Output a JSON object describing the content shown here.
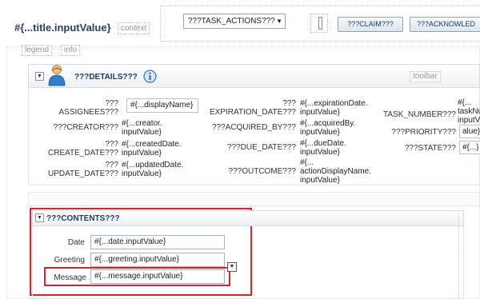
{
  "header": {
    "title": "#{...title.inputValue}",
    "context_placeholder": "context",
    "task_actions": "???TASK_ACTIONS???",
    "claim_label": "???CLAIM???",
    "acknowledge_label": "???ACKNOWLED"
  },
  "placeholders": {
    "legend": "legend",
    "info": "info",
    "toolbar": "toolbar"
  },
  "details": {
    "title": "???DETAILS???",
    "assignees": {
      "label_line1": "???",
      "label_line2": "ASSIGNEES???",
      "value": "#{...displayName}"
    },
    "creator": {
      "label": "???CREATOR???",
      "value_line1": "#{...creator.",
      "value_line2": "inputValue}"
    },
    "create_date": {
      "label_line1": "???",
      "label_line2": "CREATE_DATE???",
      "value_line1": "#{...createdDate.",
      "value_line2": "inputValue}"
    },
    "update_date": {
      "label_line1": "???",
      "label_line2": "UPDATE_DATE???",
      "value_line1": "#{...updatedDate.",
      "value_line2": "inputValue}"
    },
    "expiration_date": {
      "label_line1": "???",
      "label_line2": "EXPIRATION_DATE???",
      "value_line1": "#{...expirationDate.",
      "value_line2": "inputValue}"
    },
    "acquired_by": {
      "label": "???ACQUIRED_BY???",
      "value_line1": "#{...acquiredBy.",
      "value_line2": "inputValue}"
    },
    "due_date": {
      "label": "???DUE_DATE???",
      "value_line1": "#{...dueDate.",
      "value_line2": "inputValue}"
    },
    "outcome": {
      "label": "???OUTCOME???",
      "value_line1": "#{...",
      "value_line2": "actionDisplayName.",
      "value_line3": "inputValue}"
    },
    "task_number": {
      "label": "TASK_NUMBER???",
      "value_line1": "#{...",
      "value_line2": "taskNu",
      "value_line3": "inputV"
    },
    "priority": {
      "label": "???PRIORITY???",
      "value": "alue}"
    },
    "state": {
      "label": "???STATE???",
      "value": "#{...}"
    }
  },
  "contents": {
    "title": "???CONTENTS???",
    "date": {
      "label": "Date",
      "value": "#{...date.inputValue}"
    },
    "greeting": {
      "label": "Greeting",
      "value": "#{...greeting.inputValue}"
    },
    "message": {
      "label": "Message",
      "value": "#{...message.inputValue}"
    }
  },
  "colors": {
    "accent_red": "#e0202a",
    "header_text": "#1d3a63"
  },
  "icons": {
    "user": "user-icon",
    "info": "info-icon",
    "collapse": "collapse-toggle-icon",
    "dropdown": "dropdown-icon"
  }
}
